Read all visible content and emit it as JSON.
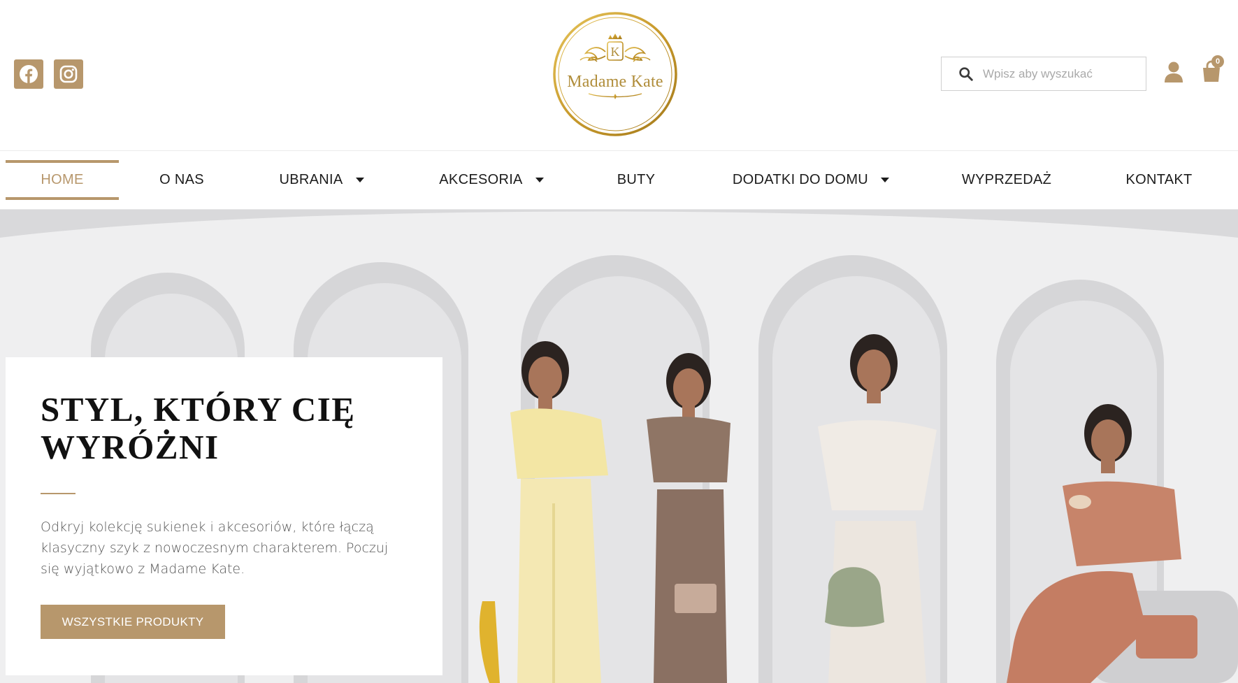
{
  "brand": {
    "logo_name": "Madame Kate",
    "logo_monogram": "K",
    "accent_color": "#b7976c",
    "logo_color": "#c9a23a"
  },
  "header": {
    "social": [
      {
        "name": "facebook",
        "icon": "facebook-icon"
      },
      {
        "name": "instagram",
        "icon": "instagram-icon"
      }
    ],
    "search": {
      "placeholder": "Wpisz aby wyszukać",
      "icon": "search-icon"
    },
    "account_icon": "user-icon",
    "cart": {
      "icon": "shopping-bag-icon",
      "count": "0"
    }
  },
  "nav": {
    "items": [
      {
        "label": "HOME",
        "active": true,
        "dropdown": false
      },
      {
        "label": "O NAS",
        "active": false,
        "dropdown": false
      },
      {
        "label": "UBRANIA",
        "active": false,
        "dropdown": true
      },
      {
        "label": "AKCESORIA",
        "active": false,
        "dropdown": true
      },
      {
        "label": "BUTY",
        "active": false,
        "dropdown": false
      },
      {
        "label": "DODATKI DO DOMU",
        "active": false,
        "dropdown": true
      },
      {
        "label": "WYPRZEDAŻ",
        "active": false,
        "dropdown": false
      },
      {
        "label": "KONTAKT",
        "active": false,
        "dropdown": false
      }
    ]
  },
  "hero": {
    "title": "STYL, KTÓRY CIĘ WYRÓŻNI",
    "text": "Odkryj kolekcję sukienek i akcesoriów, które łączą klasyczny szyk z nowoczesnym charakterem. Poczuj się wyjątkowo z Madame Kate.",
    "button_label": "WSZYSTKIE PRODUKTY"
  }
}
